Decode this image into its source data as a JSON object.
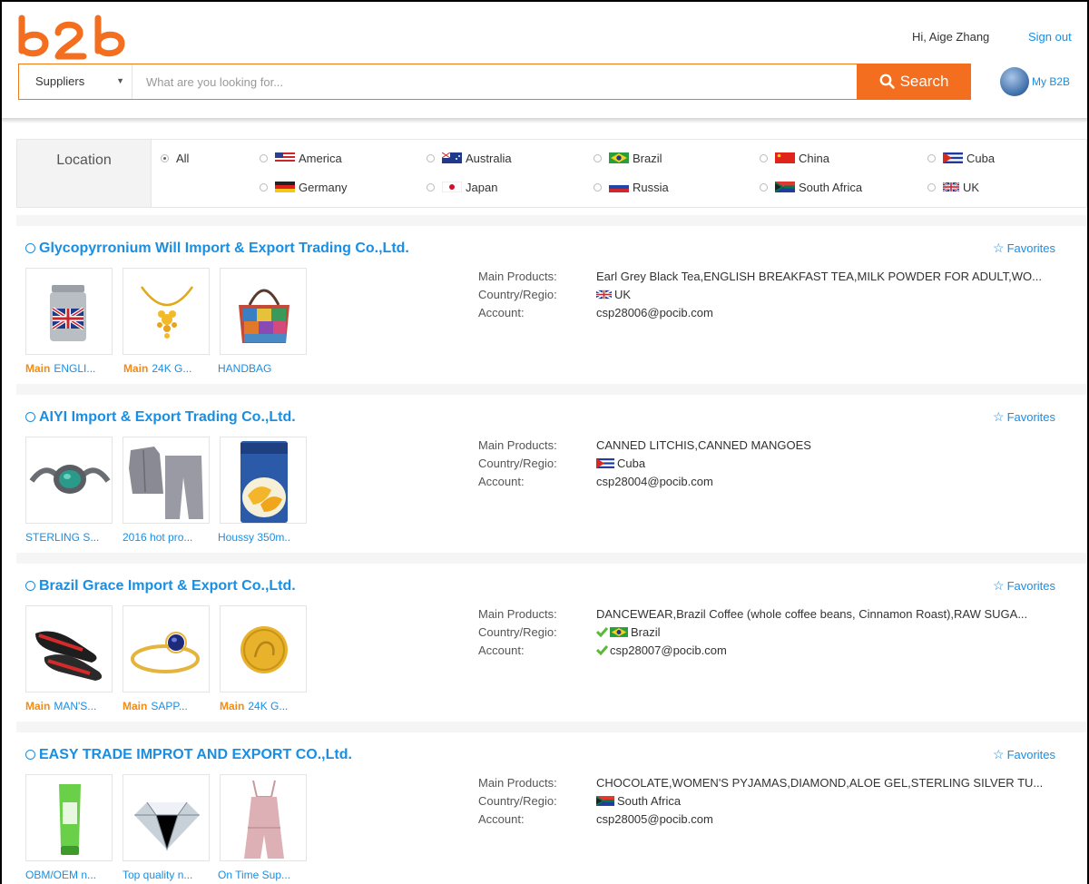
{
  "header": {
    "greeting": "Hi, Aige Zhang",
    "sign_out": "Sign out",
    "my_b2b": "My B2B"
  },
  "search": {
    "type_value": "Suppliers",
    "placeholder": "What are you looking for...",
    "button": "Search"
  },
  "filter": {
    "label": "Location",
    "options": [
      "All",
      "America",
      "Australia",
      "Brazil",
      "China",
      "Cuba",
      "Germany",
      "Japan",
      "Russia",
      "South Africa",
      "UK"
    ],
    "selected": "All"
  },
  "labels": {
    "main_products": "Main Products:",
    "country": "Country/Regio:",
    "account": "Account:",
    "favorites": "Favorites",
    "main_badge": "Main"
  },
  "results": [
    {
      "company": "Glycopyrronium Will Import & Export Trading Co.,Ltd.",
      "main_products": "Earl Grey Black Tea,ENGLISH BREAKFAST TEA,MILK POWDER FOR ADULT,WO...",
      "country": "UK",
      "account": "csp28006@pocib.com",
      "products": [
        {
          "caption": "ENGLI...",
          "main": true,
          "icon": "tea-tin-icon"
        },
        {
          "caption": "24K G...",
          "main": true,
          "icon": "gold-necklace-icon"
        },
        {
          "caption": "HANDBAG",
          "main": false,
          "icon": "handbag-icon"
        }
      ]
    },
    {
      "company": "AIYI Import & Export Trading Co.,Ltd.",
      "main_products": "CANNED LITCHIS,CANNED MANGOES",
      "country": "Cuba",
      "account": "csp28004@pocib.com",
      "products": [
        {
          "caption": "STERLING S...",
          "main": false,
          "icon": "bracelet-icon"
        },
        {
          "caption": "2016 hot pro...",
          "main": false,
          "icon": "pajamas-icon"
        },
        {
          "caption": "Houssy 350m..",
          "main": false,
          "icon": "canned-mango-icon"
        }
      ]
    },
    {
      "company": "Brazil Grace Import & Export Co.,Ltd.",
      "main_products": "DANCEWEAR,Brazil Coffee (whole coffee beans, Cinnamon Roast),RAW SUGA...",
      "country": "Brazil",
      "account": "csp28007@pocib.com",
      "products": [
        {
          "caption": "MAN'S...",
          "main": true,
          "icon": "dance-shoes-icon"
        },
        {
          "caption": "SAPP...",
          "main": true,
          "icon": "sapphire-ring-icon"
        },
        {
          "caption": "24K G...",
          "main": true,
          "icon": "gold-coin-icon"
        }
      ]
    },
    {
      "company": "EASY TRADE IMPROT AND EXPORT CO.,Ltd.",
      "main_products": "CHOCOLATE,WOMEN'S PYJAMAS,DIAMOND,ALOE GEL,STERLING SILVER TU...",
      "country": "South Africa",
      "account": "csp28005@pocib.com",
      "products": [
        {
          "caption": "OBM/OEM n...",
          "main": false,
          "icon": "aloe-gel-tube-icon"
        },
        {
          "caption": "Top quality n...",
          "main": false,
          "icon": "diamond-icon"
        },
        {
          "caption": "On Time Sup...",
          "main": false,
          "icon": "pink-jumpsuit-icon"
        }
      ]
    }
  ],
  "colors": {
    "accent_orange": "#f36e1f",
    "link_blue": "#1a8ee1",
    "badge_orange": "#f08c1a"
  }
}
